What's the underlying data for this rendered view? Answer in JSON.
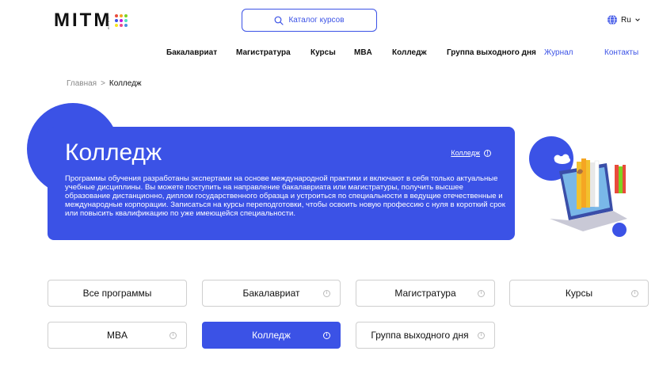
{
  "header": {
    "logo_text": "MITM",
    "logo_small": "ИНСТИТУТ",
    "search_label": "Каталог курсов",
    "lang_label": "Ru"
  },
  "nav": {
    "items": [
      {
        "label": "Бакалавриат"
      },
      {
        "label": "Магистратура"
      },
      {
        "label": "Курсы"
      },
      {
        "label": "MBA"
      },
      {
        "label": "Колледж"
      },
      {
        "label": "Группа выходного дня"
      },
      {
        "label": "Журнал"
      },
      {
        "label": "Контакты"
      }
    ]
  },
  "breadcrumb": {
    "home": "Главная",
    "separator": ">",
    "current": "Колледж"
  },
  "hero": {
    "title": "Колледж",
    "link_label": "Колледж",
    "description": "Программы обучения разработаны экспертами на основе международной практики и включают в себя только актуальные учебные дисциплины. Вы можете поступить на направление бакалавриата или магистратуры, получить высшее образование дистанционно, диплом государственного образца и устроиться по специальности в ведущие отечественные и международные корпорации. Записаться на курсы переподготовки, чтобы освоить новую профессию с нуля в короткий срок или повысить квалификацию по уже имеющейся специальности."
  },
  "filters": [
    {
      "label": "Все программы",
      "active": false
    },
    {
      "label": "Бакалавриат",
      "active": false
    },
    {
      "label": "Магистратура",
      "active": false
    },
    {
      "label": "Курсы",
      "active": false
    },
    {
      "label": "MBA",
      "active": false
    },
    {
      "label": "Колледж",
      "active": true
    },
    {
      "label": "Группа выходного дня",
      "active": false
    }
  ],
  "colors": {
    "accent": "#3b52e6",
    "border": "#cfcfcf"
  },
  "icons": {
    "search": "search-icon",
    "globe": "globe-icon",
    "chevron": "chevron-down-icon",
    "info": "info-icon"
  }
}
